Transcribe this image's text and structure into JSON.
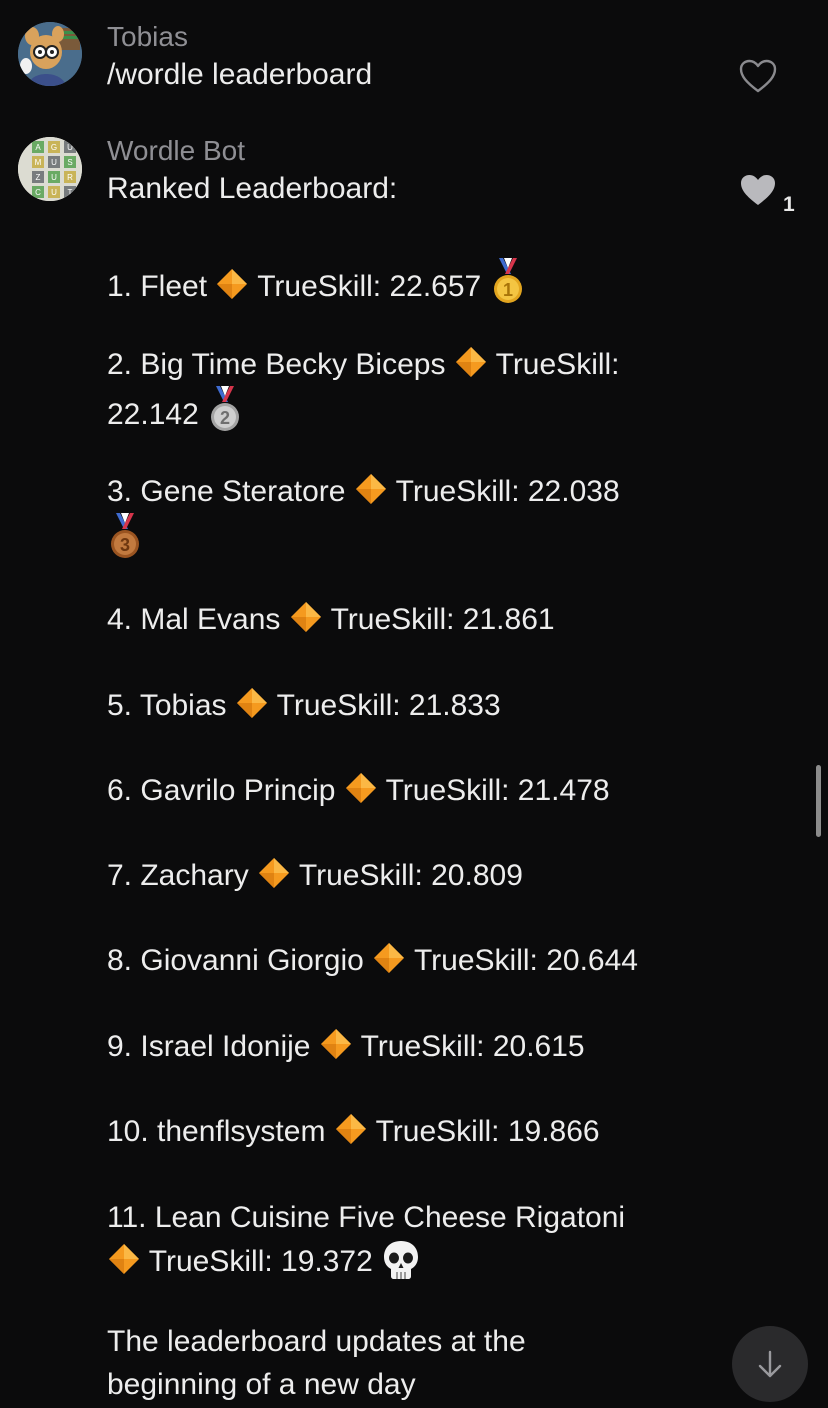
{
  "messages": [
    {
      "sender": "Tobias",
      "text": "/wordle leaderboard",
      "liked": false
    },
    {
      "sender": "Wordle Bot",
      "header": "Ranked Leaderboard:",
      "like_count": "1",
      "liked": true,
      "avatar_letters": [
        "A",
        "G",
        "U",
        "M",
        "U",
        "S",
        "Z",
        "U",
        "R",
        "C",
        "U",
        "T"
      ],
      "entries": [
        {
          "line1": "1. Fleet",
          "sep": "🔶",
          "score": "TrueSkill: 22.657",
          "badge": "gold-medal"
        },
        {
          "line1": "2. Big Time Becky Biceps",
          "sep": "🔶",
          "score": "TrueSkill:",
          "line2": "22.142",
          "badge": "silver-medal"
        },
        {
          "line1": "3. Gene Steratore",
          "sep": "🔶",
          "score": "TrueSkill: 22.038",
          "badge": "bronze-medal"
        },
        {
          "line1": "4. Mal Evans",
          "sep": "🔶",
          "score": "TrueSkill: 21.861"
        },
        {
          "line1": "5. Tobias",
          "sep": "🔶",
          "score": "TrueSkill: 21.833"
        },
        {
          "line1": "6. Gavrilo Princip",
          "sep": "🔶",
          "score": "TrueSkill: 21.478"
        },
        {
          "line1": "7. Zachary",
          "sep": "🔶",
          "score": "TrueSkill: 20.809"
        },
        {
          "line1": "8. Giovanni Giorgio",
          "sep": "🔶",
          "score": "TrueSkill: 20.644"
        },
        {
          "line1": "9. Israel Idonije",
          "sep": "🔶",
          "score": "TrueSkill: 20.615"
        },
        {
          "line1": "10. thenflsystem",
          "sep": "🔶",
          "score": "TrueSkill: 19.866"
        },
        {
          "line1": "11. Lean Cuisine Five Cheese Rigatoni",
          "sep": "🔶",
          "score": "TrueSkill: 19.372",
          "badge": "skull"
        }
      ],
      "footer": [
        "The leaderboard updates at the",
        "beginning of a new day"
      ]
    }
  ],
  "icons": {
    "heart_outline": "heart-outline-icon",
    "heart_filled": "heart-filled-icon",
    "scroll_down": "arrow-down-icon",
    "separator": "orange-diamond-icon"
  },
  "colors": {
    "background": "#0b0b0c",
    "diamond": "#f59a1f",
    "gold": "#e8b32a",
    "silver": "#b9b9b9",
    "bronze": "#b4672f"
  }
}
